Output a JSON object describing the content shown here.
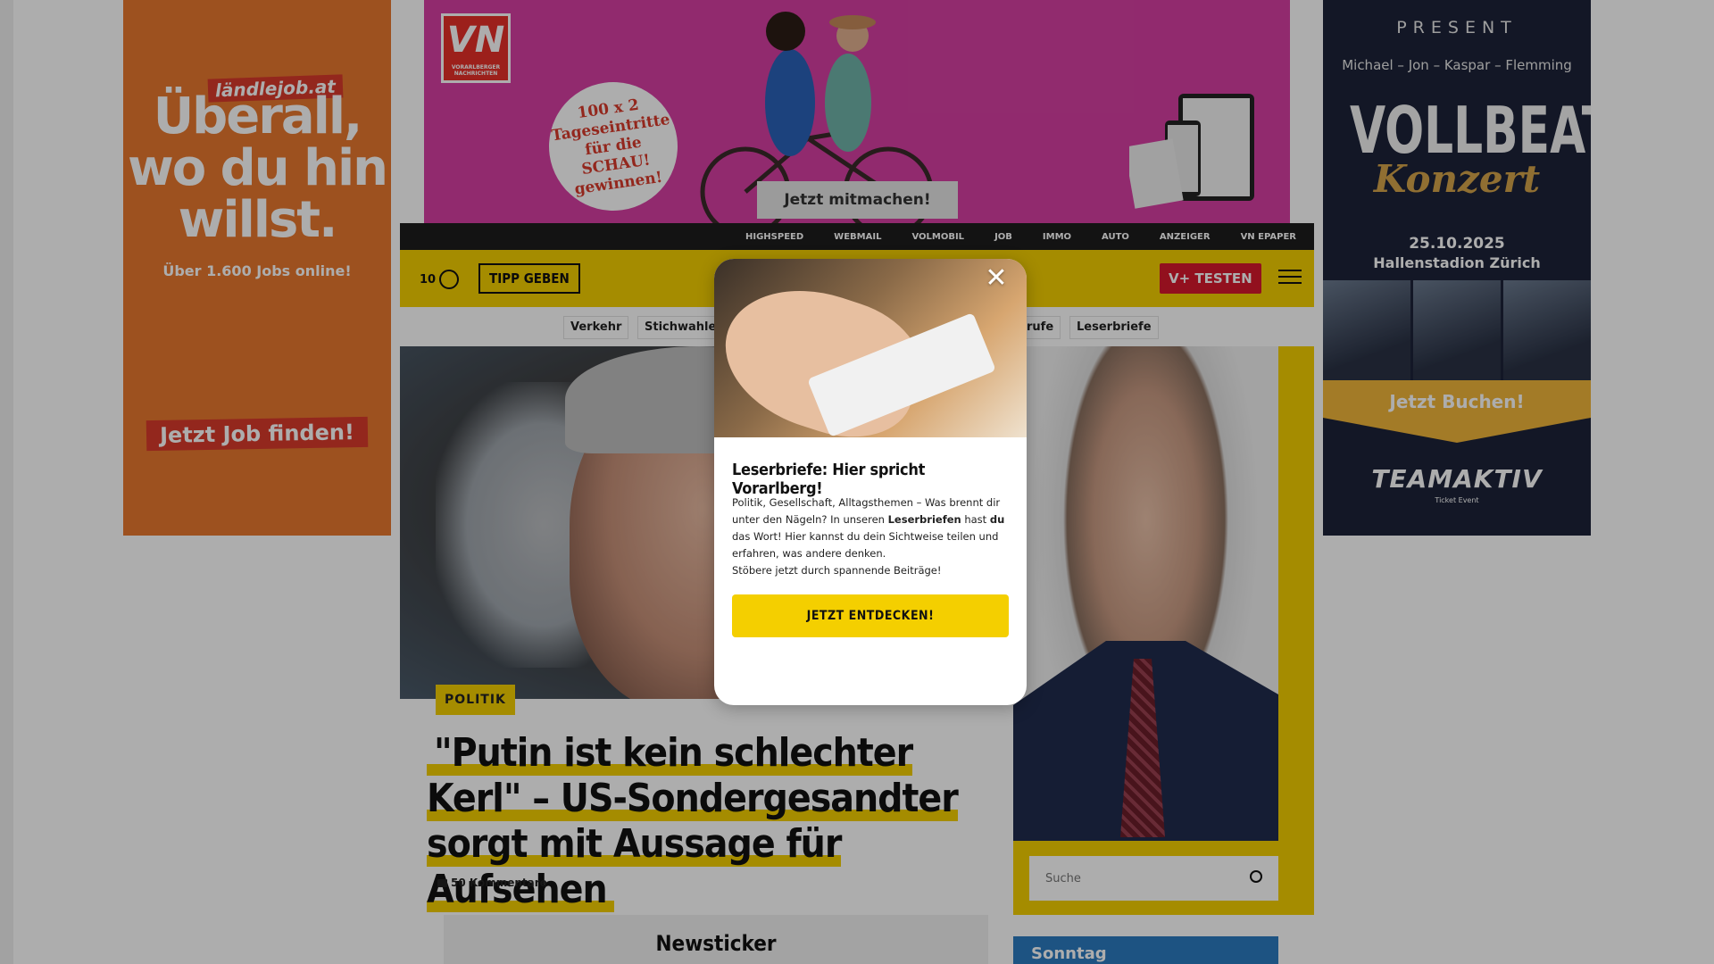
{
  "ads": {
    "left": {
      "brand": "ländlejob.at",
      "headline": "Überall, wo du hin willst.",
      "sub": "Über 1.600 Jobs online!",
      "cta": "Jetzt Job finden!",
      "bg_color": "#e8782f",
      "accent_color": "#d93a2b"
    },
    "top": {
      "logo_text": "VN",
      "logo_sub": "VORARLBERGER NACHRICHTEN",
      "promo": "100 x 2 Tageseintritte für die SCHAU! gewinnen!",
      "cta": "Jetzt mitmachen!",
      "bg_color": "#d63fa2"
    },
    "right": {
      "present": "PRESENT",
      "names": "Michael – Jon – Kaspar – Flemming",
      "band": "VOLLBEAT",
      "event": "Konzert",
      "date": "25.10.2025",
      "venue": "Hallenstadion Zürich",
      "cta": "Jetzt Buchen!",
      "organizer": "TEAMAKTIV",
      "organizer_sub": "Ticket Event"
    }
  },
  "topnav": {
    "items": [
      "HIGHSPEED",
      "WEBMAIL",
      "VOLMOBIL",
      "JOB",
      "IMMO",
      "AUTO",
      "ANZEIGER",
      "VN EPAPER"
    ]
  },
  "header": {
    "weather_temp": "10",
    "weather_icon": "sun-cloud-icon",
    "tipp_label": "TIPP GEBEN",
    "vplus_label": "V+ TESTEN",
    "menu_icon": "menu-search-icon",
    "accent_color": "#f4cf00"
  },
  "tags": {
    "items": [
      "Verkehr",
      "Stichwahlen",
      "rufe",
      "Leserbriefe"
    ]
  },
  "article": {
    "category": "POLITIK",
    "headline": "\"Putin ist kein schlechter Kerl\" – US-Sondergesandter sorgt mit Aussage für Aufsehen",
    "comments": "50 Kommentare"
  },
  "newsticker": {
    "title": "Newsticker"
  },
  "sidebar": {
    "search_placeholder": "Suche",
    "teaser_label": "Sonntag"
  },
  "modal": {
    "title": "Leserbriefe: Hier spricht Vorarlberg!",
    "body_p1": "Politik, Gesellschaft, Alltagsthemen – Was brennt dir unter den Nägeln? In unseren ",
    "body_b1": "Leserbriefen",
    "body_p2": " hast ",
    "body_b2": "du",
    "body_p3": " das Wort! Hier kannst du dein Sichtweise teilen und erfahren, was andere denken.",
    "body_p4": "Stöbere jetzt durch spannende Beiträge!",
    "cta": "JETZT ENTDECKEN!",
    "close": "✕"
  }
}
